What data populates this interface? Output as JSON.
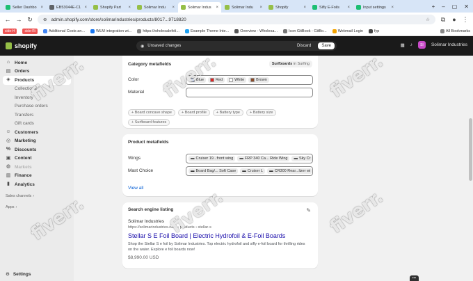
{
  "browser": {
    "tabs": [
      {
        "label": "Seller Dashbo",
        "color": "#1dbf73",
        "active": false
      },
      {
        "label": "EB53044E-C1",
        "color": "#5f6368",
        "active": false
      },
      {
        "label": "Shopify Part",
        "color": "#95bf47",
        "active": false
      },
      {
        "label": "Solimar Indu",
        "color": "#95bf47",
        "active": false
      },
      {
        "label": "Solimar Indus",
        "color": "#95bf47",
        "active": true
      },
      {
        "label": "Solimar Indu",
        "color": "#95bf47",
        "active": false
      },
      {
        "label": "Shopify",
        "color": "#95bf47",
        "active": false
      },
      {
        "label": "Sifly E-Foils",
        "color": "#1dbf73",
        "active": false
      },
      {
        "label": "Input settings",
        "color": "#1dbf73",
        "active": false
      }
    ],
    "url": "admin.shopify.com/store/solimarindustries/products/8017...9718820",
    "bookmarks": [
      "side-H",
      "side-Ri",
      "Additional Costs an...",
      "WLM integration wi...",
      "https://wholesalefeli...",
      "Example Theme Inte...",
      "Overview - Wholesa...",
      "Icon GitBook - GitBo...",
      "Webmail Login",
      "fyp",
      "All Bookmarks"
    ]
  },
  "topbar": {
    "brand": "shopify",
    "unsaved": "Unsaved changes",
    "discard": "Discard",
    "save": "Save",
    "store_name": "Solimar Industries",
    "store_initials": "SI"
  },
  "sidebar": {
    "home": "Home",
    "orders": "Orders",
    "products": "Products",
    "collections": "Collections",
    "inventory": "Inventory",
    "purchase_orders": "Purchase orders",
    "transfers": "Transfers",
    "gift_cards": "Gift cards",
    "customers": "Customers",
    "marketing": "Marketing",
    "discounts": "Discounts",
    "content": "Content",
    "markets": "Markets",
    "finance": "Finance",
    "analytics": "Analytics",
    "sales_channels": "Sales channels",
    "apps": "Apps",
    "settings": "Settings"
  },
  "category_card": {
    "title": "Category metafields",
    "badge_strong": "Surfboards",
    "badge_rest": "in Surfing",
    "color_label": "Color",
    "colors": [
      {
        "name": "Blue",
        "hex": "#2f5fd1"
      },
      {
        "name": "Red",
        "hex": "#e02424"
      },
      {
        "name": "White",
        "hex": "#ffffff"
      },
      {
        "name": "Brown",
        "hex": "#8a4b2a"
      }
    ],
    "material_label": "Material",
    "pills": [
      "Board concave shape",
      "Board profile",
      "Battery type",
      "Battery size",
      "Surfboard features"
    ]
  },
  "product_card": {
    "title": "Product metafields",
    "wings_label": "Wings",
    "wings": [
      "Cruiser 19...front wing",
      "FRP 340 Ca... Ride Wing",
      "Sky Cr"
    ],
    "mast_label": "Mast Choice",
    "mast": [
      "Board Bag/... Soft Case",
      "Cruiser L",
      "CR300 Rear...lizer wi"
    ],
    "view_all": "View all"
  },
  "seo_card": {
    "title": "Search engine listing",
    "store": "Solimar Industries",
    "url": "https://solimarindustries.com › products › stellar-s",
    "page_title": "Stellar S E Foil Board | Electric Hydrofoil & E-Foil Boards",
    "description": "Shop the Stellar S e foil by Solimar Industries. Top electric hydrofoil and sifly e-foil board for thrilling rides on the water. Explore e foil boards now!",
    "price": "$8,990.00 USD"
  },
  "watermark": "fiverr."
}
